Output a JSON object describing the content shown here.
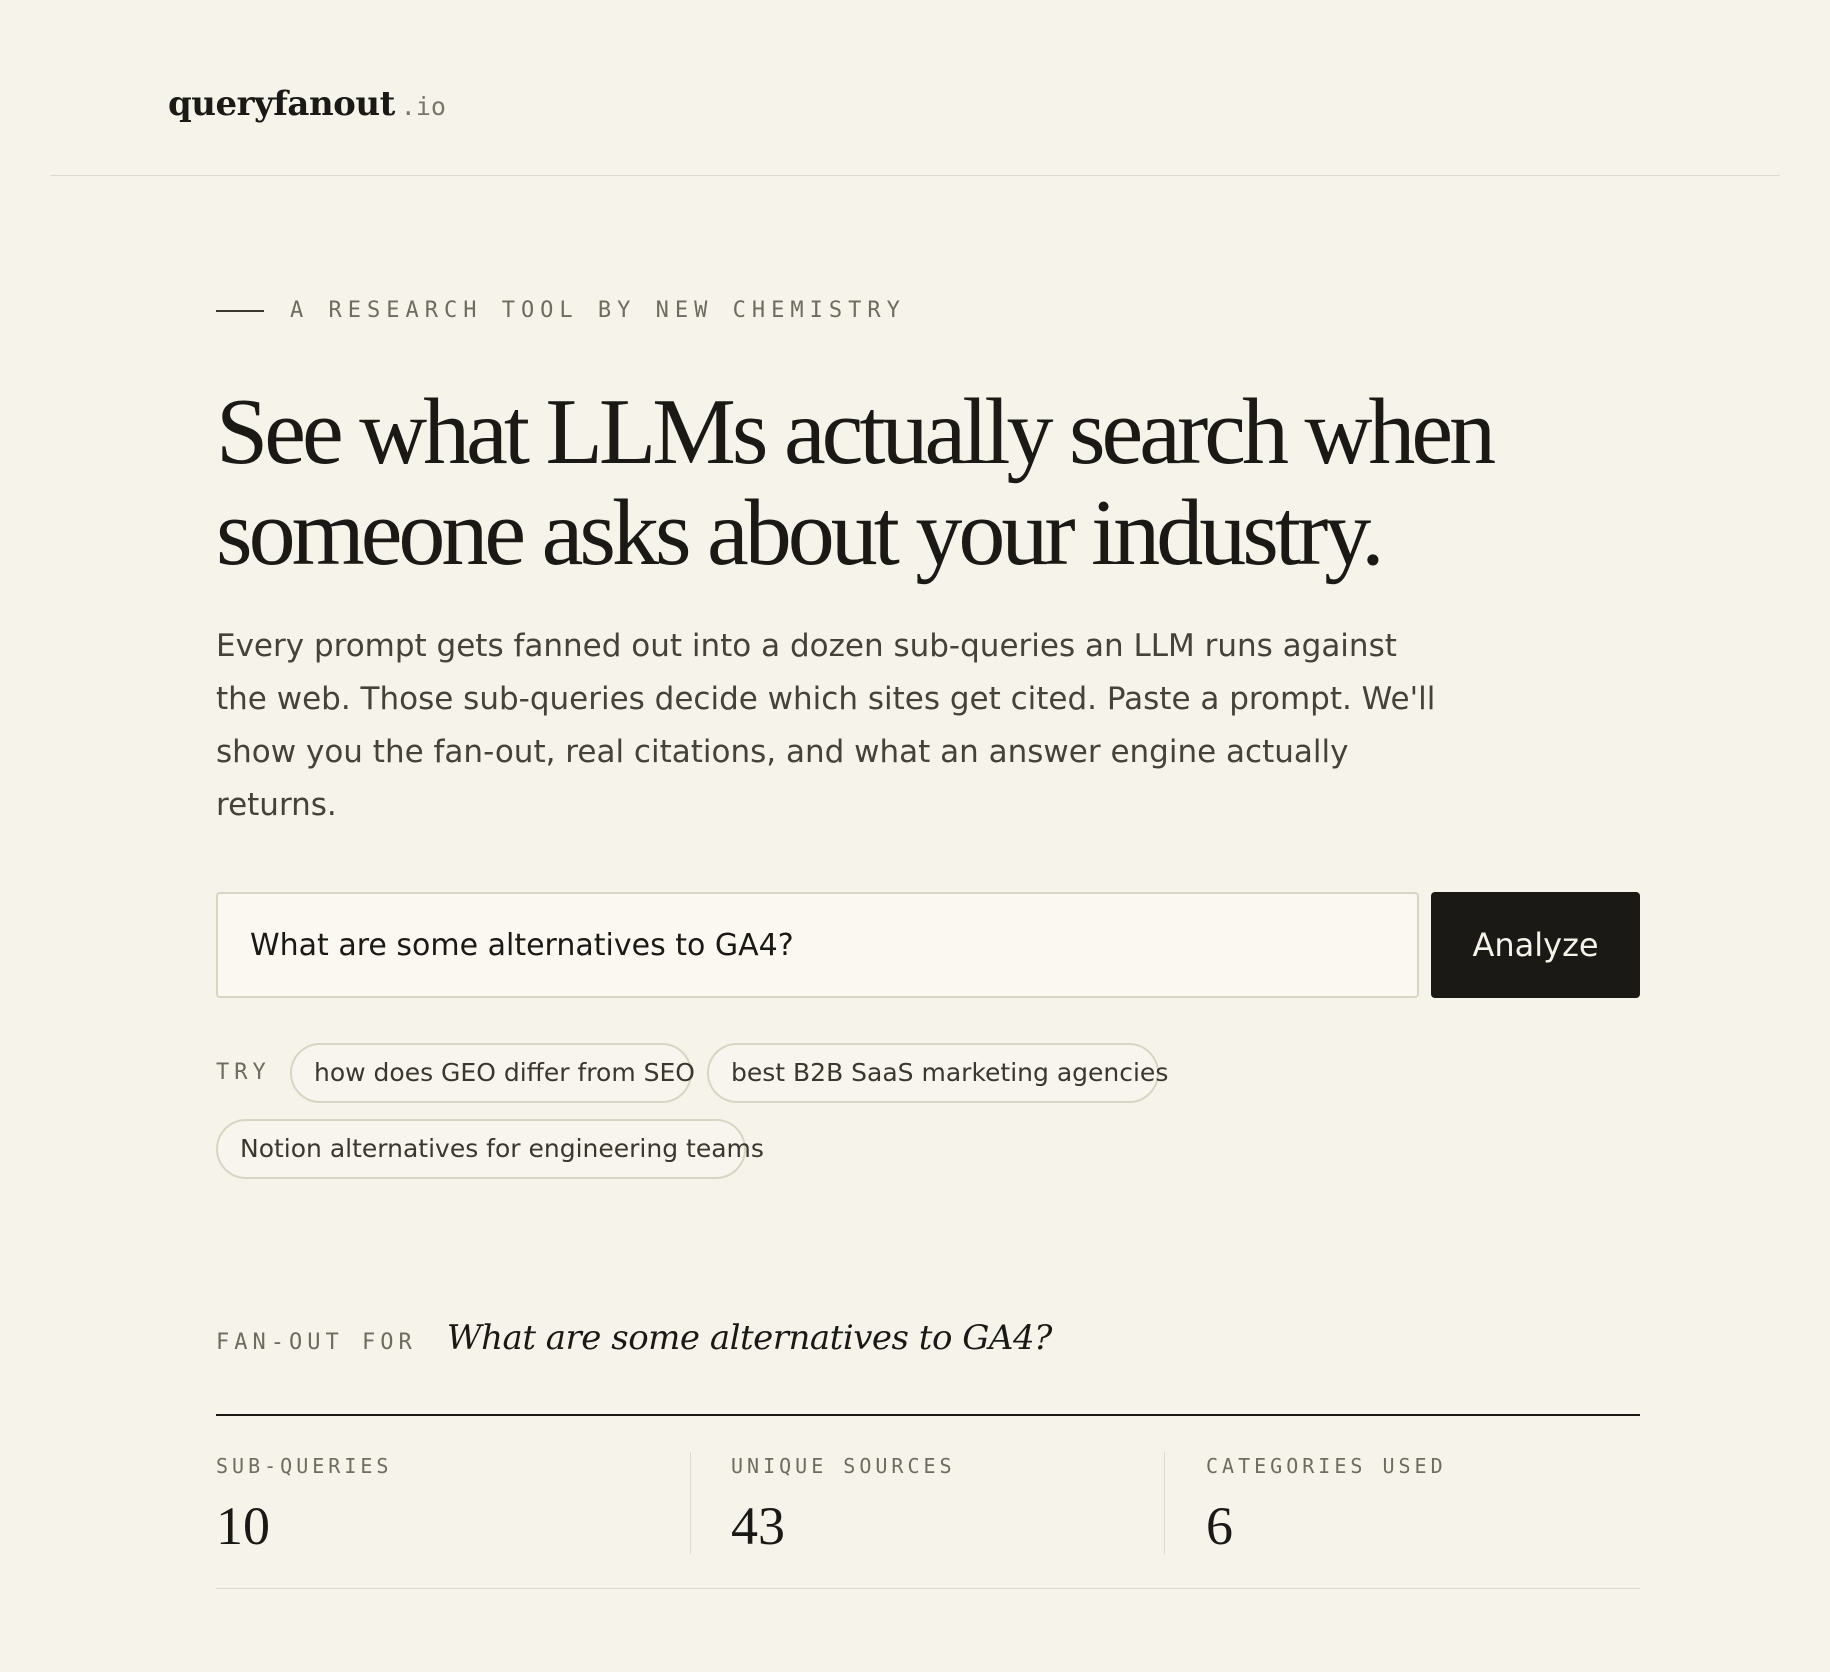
{
  "header": {
    "logo_name": "queryfanout",
    "logo_tld": ".io"
  },
  "hero": {
    "eyebrow": "A RESEARCH TOOL BY NEW CHEMISTRY",
    "headline": "See what LLMs actually search when someone asks about your industry.",
    "lede": "Every prompt gets fanned out into a dozen sub-queries an LLM runs against the web. Those sub-queries decide which sites get cited. Paste a prompt. We'll show you the fan-out, real citations, and what an answer engine actually returns."
  },
  "search": {
    "value": "What are some alternatives to GA4?",
    "button_label": "Analyze"
  },
  "suggestions": {
    "label": "TRY",
    "items": [
      "how does GEO differ from SEO",
      "best B2B SaaS marketing agencies",
      "Notion alternatives for engineering teams"
    ]
  },
  "fanout": {
    "label": "FAN-OUT FOR",
    "prompt": "What are some alternatives to GA4?"
  },
  "stats": [
    {
      "label": "SUB-QUERIES",
      "value": "10"
    },
    {
      "label": "UNIQUE SOURCES",
      "value": "43"
    },
    {
      "label": "CATEGORIES USED",
      "value": "6"
    }
  ]
}
